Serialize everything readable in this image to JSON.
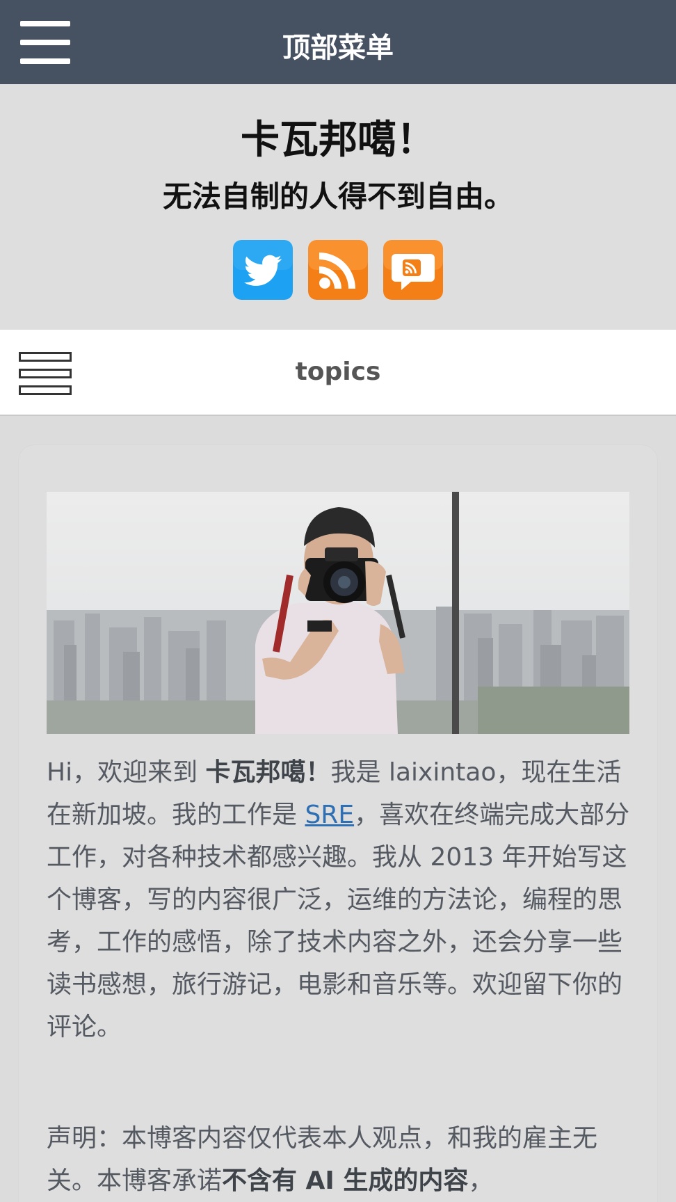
{
  "topbar": {
    "title": "顶部菜单",
    "menu_icon": "hamburger-menu-icon"
  },
  "header": {
    "site_title": "卡瓦邦噶！",
    "motto": "无法自制的人得不到自由。",
    "social": [
      {
        "icon": "twitter-icon",
        "color": "#1da1f2"
      },
      {
        "icon": "rss-feed-icon",
        "color": "#f57f17"
      },
      {
        "icon": "comments-feed-icon",
        "color": "#f57f17"
      }
    ]
  },
  "topics_bar": {
    "label": "topics",
    "menu_icon": "topics-menu-icon"
  },
  "intro": {
    "t1": "Hi，欢迎来到 ",
    "site_name": "卡瓦邦噶！",
    "t2": "我是 laixintao，现在生活在新加坡。我的工作是 ",
    "sre_link": "SRE",
    "t3": "，喜欢在终端完成大部分工作，对各种技术都感兴趣。我从 2013 年开始写这个博客，写的内容很广泛，运维的方法论，编程的思考，工作的感悟，除了技术内容之外，还会分享一些读书感想，旅行游记，电影和音乐等。欢迎留下你的评论。"
  },
  "notice": {
    "t1": "声明：本博客内容仅代表本人观点，和我的雇主无关。本博客承诺",
    "bold": "不含有 AI 生成的内容",
    "t2": "，"
  },
  "colors": {
    "topbar_bg": "#465162",
    "header_bg": "#dedede",
    "link": "#2f6fb3"
  }
}
